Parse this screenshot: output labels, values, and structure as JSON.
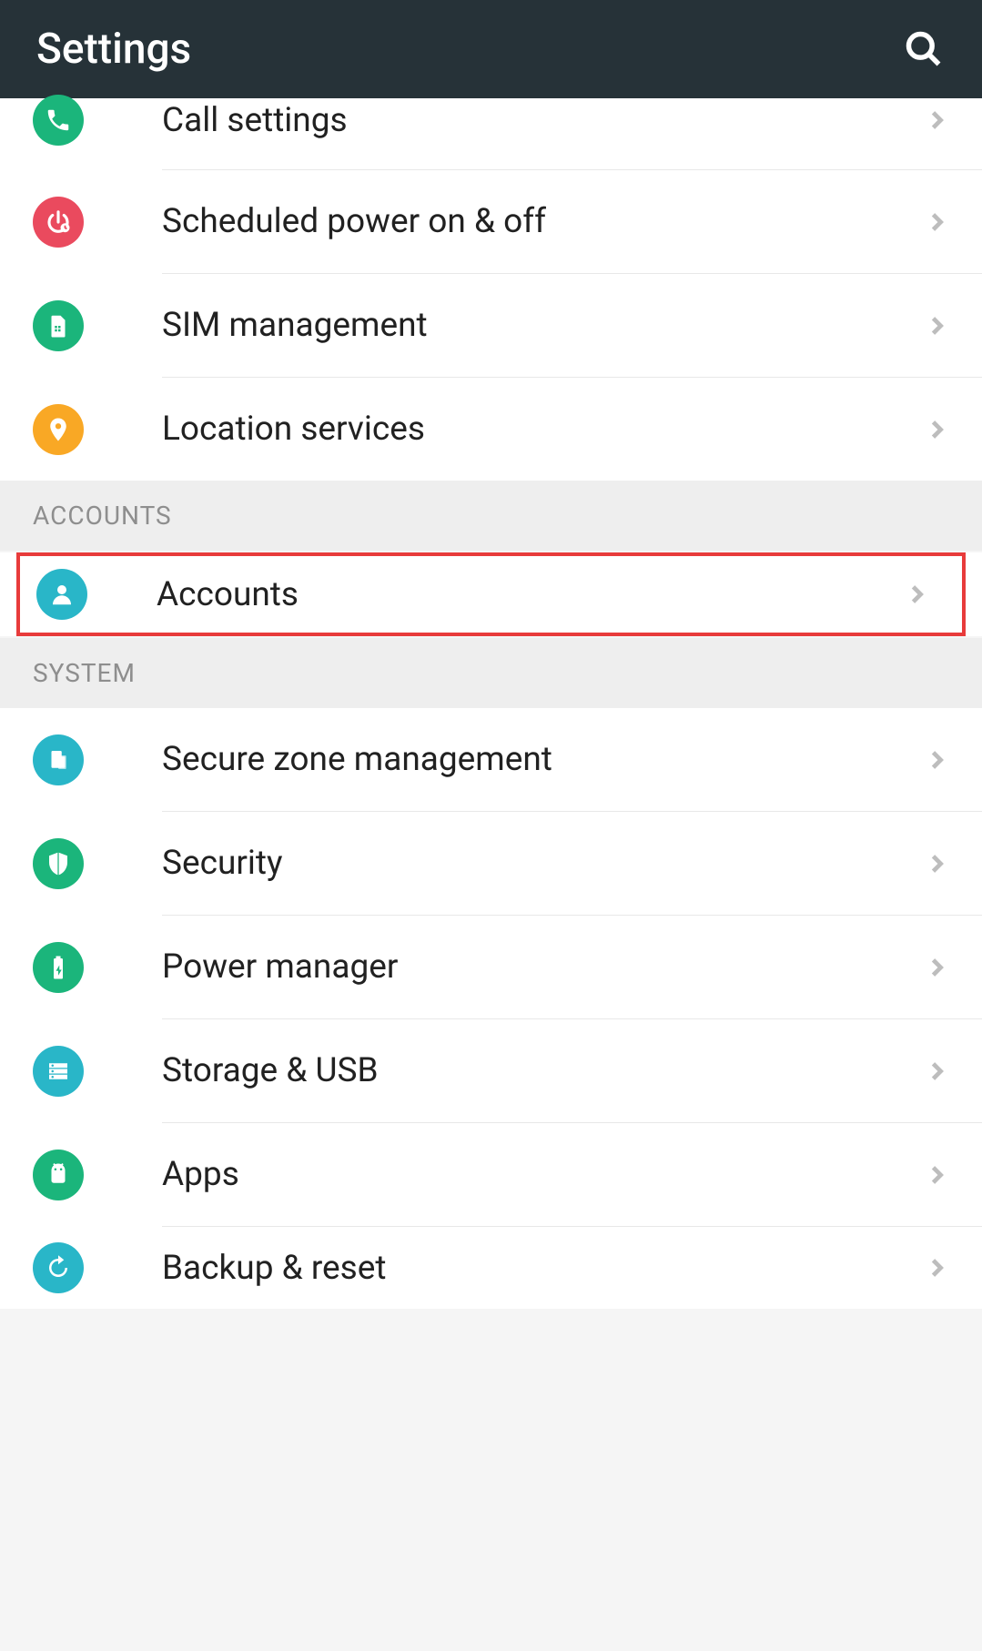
{
  "header": {
    "title": "Settings"
  },
  "groups": [
    {
      "header": null,
      "items": [
        {
          "id": "call-settings",
          "label": "Call settings",
          "icon": "phone",
          "color": "green",
          "partial": true
        },
        {
          "id": "scheduled-power",
          "label": "Scheduled power on & off",
          "icon": "power-clock",
          "color": "red"
        },
        {
          "id": "sim-management",
          "label": "SIM management",
          "icon": "sim",
          "color": "green"
        },
        {
          "id": "location-services",
          "label": "Location services",
          "icon": "location",
          "color": "orange"
        }
      ]
    },
    {
      "header": "ACCOUNTS",
      "items": [
        {
          "id": "accounts",
          "label": "Accounts",
          "icon": "person",
          "color": "cyan",
          "highlighted": true
        }
      ]
    },
    {
      "header": "SYSTEM",
      "items": [
        {
          "id": "secure-zone",
          "label": "Secure zone management",
          "icon": "devices",
          "color": "cyan"
        },
        {
          "id": "security",
          "label": "Security",
          "icon": "shield",
          "color": "green"
        },
        {
          "id": "power-manager",
          "label": "Power manager",
          "icon": "battery",
          "color": "green"
        },
        {
          "id": "storage-usb",
          "label": "Storage & USB",
          "icon": "storage",
          "color": "cyan"
        },
        {
          "id": "apps",
          "label": "Apps",
          "icon": "android",
          "color": "green"
        },
        {
          "id": "backup-reset",
          "label": "Backup & reset",
          "icon": "refresh",
          "color": "cyan"
        }
      ]
    }
  ]
}
